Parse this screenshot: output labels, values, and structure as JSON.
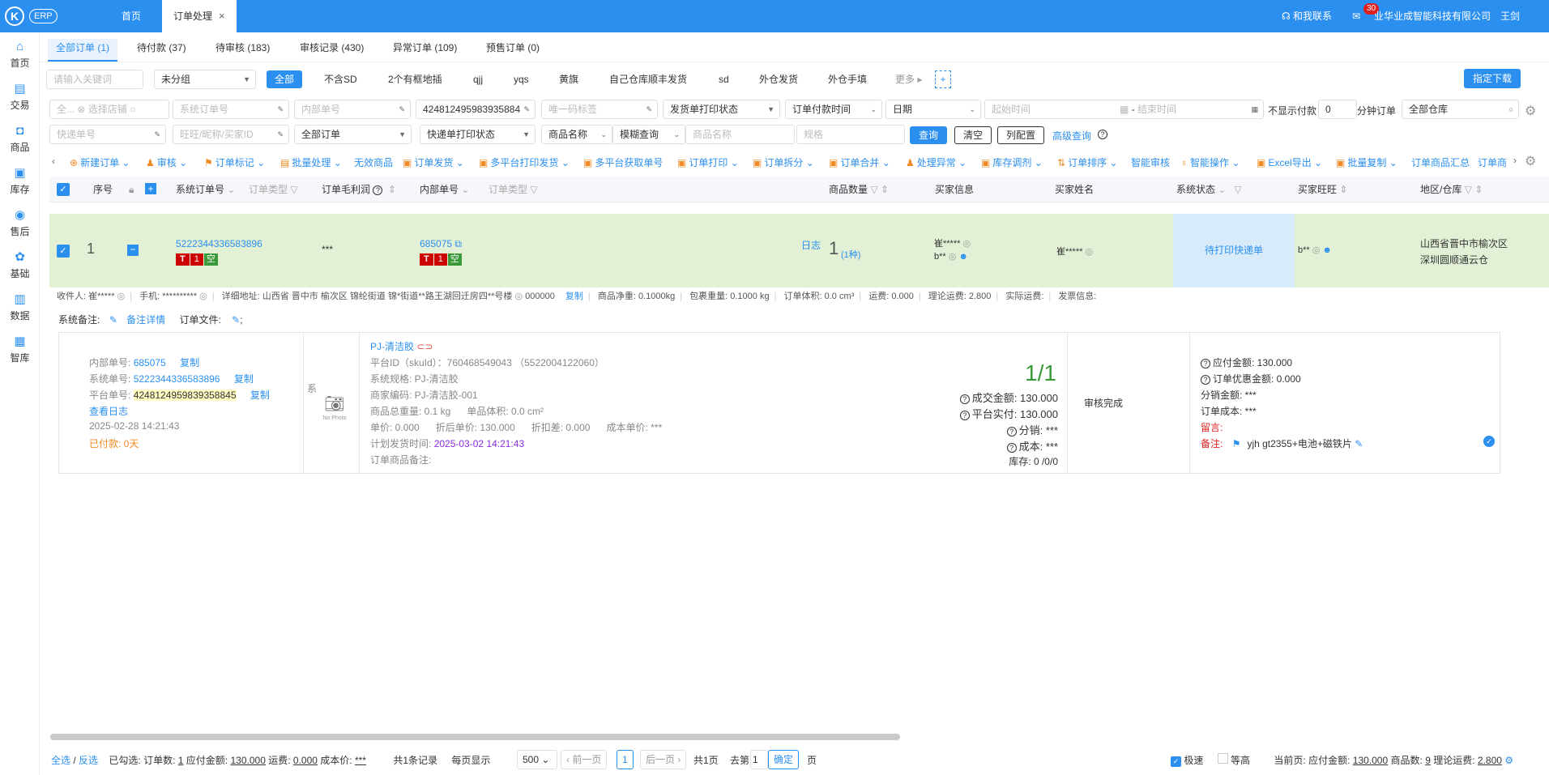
{
  "topbar": {
    "logo": "K",
    "erp": "ERP",
    "tabs": [
      {
        "label": "首页"
      },
      {
        "label": "订单处理"
      }
    ],
    "contact": "和我联系",
    "notifications": "30",
    "company": "业华业成智能科技有限公司",
    "user": "王剑"
  },
  "sidebar": [
    {
      "label": "首页",
      "icon": "home-icon"
    },
    {
      "label": "交易",
      "icon": "trade-icon"
    },
    {
      "label": "商品",
      "icon": "goods-icon"
    },
    {
      "label": "库存",
      "icon": "inventory-icon"
    },
    {
      "label": "售后",
      "icon": "after-sales-icon"
    },
    {
      "label": "基础",
      "icon": "settings-icon"
    },
    {
      "label": "数据",
      "icon": "chart-icon"
    },
    {
      "label": "智库",
      "icon": "library-icon"
    }
  ],
  "order_tabs": [
    "全部订单 (1)",
    "待付款 (37)",
    "待审核 (183)",
    "审核记录 (430)",
    "异常订单 (109)",
    "预售订单 (0)"
  ],
  "filter_row1": {
    "keyword_placeholder": "请输入关键词",
    "group": "未分组",
    "chips": [
      "全部",
      "不含SD",
      "2个有框地插",
      "qjj",
      "yqs",
      "黄旗",
      "自己仓库顺丰发货",
      "sd",
      "外仓发货",
      "外仓手填"
    ],
    "more": "更多",
    "add": "+",
    "download": "指定下载"
  },
  "filter_row2": {
    "shop": "全...",
    "shop_placeholder": "选择店铺",
    "sys_order_placeholder": "系统订单号",
    "inner_order_placeholder": "内部单号",
    "platform_order": "424812495983935884",
    "unique_code_placeholder": "唯一码标签",
    "print_status": "发货单打印状态",
    "pay_time": "订单付款时间",
    "date": "日期",
    "start_placeholder": "起始时间",
    "dash": "-",
    "end_placeholder": "结束时间",
    "hide_paid_label": "不显示付款",
    "hide_paid_value": "0",
    "split_label": "分钟订单",
    "warehouse": "全部仓库"
  },
  "filter_row3": {
    "express_placeholder": "快递单号",
    "buyer_placeholder": "旺旺/昵称/买家ID",
    "all_orders": "全部订单",
    "express_print": "快递单打印状态",
    "goods_name": "商品名称",
    "fuzzy": "模糊查询",
    "goods_name_placeholder": "商品名称",
    "spec_placeholder": "规格",
    "query": "查询",
    "clear": "清空",
    "columns": "列配置",
    "advanced": "高级查询"
  },
  "toolbar": [
    "新建订单",
    "审核",
    "订单标记",
    "批量处理",
    "无效商品",
    "订单发货",
    "多平台打印发货",
    "多平台获取单号",
    "订单打印",
    "订单拆分",
    "订单合并",
    "处理异常",
    "库存调剂",
    "订单排序",
    "智能审核",
    "智能操作",
    "Excel导出",
    "批量复制",
    "订单商品汇总",
    "订单商"
  ],
  "columns": {
    "seq": "序号",
    "sys_order": "系统订单号",
    "order_type": "订单类型",
    "margin": "订单毛利润",
    "inner_no": "内部单号",
    "order_type2": "订单类型",
    "qty": "商品数量",
    "buyer_info": "买家信息",
    "buyer_name": "买家姓名",
    "sys_status": "系统状态",
    "buyer_ww": "买家旺旺",
    "region": "地区/仓库"
  },
  "order": {
    "seq": "1",
    "sys_order": "5222344336583896",
    "tag_t": "T",
    "tag_1": "1",
    "tag_k": "空",
    "margin": "***",
    "inner_no": "685075",
    "log": "日志",
    "qty": "1",
    "qty_kinds": "(1种)",
    "buyer_info1": "崔*****",
    "buyer_info2": "b**",
    "buyer_name": "崔*****",
    "status": "待打印快递单",
    "buyer_ww": "b**",
    "region1": "山西省晋中市榆次区",
    "region2": "深圳圆顺通云仓"
  },
  "info_bar": {
    "receiver": "收件人: 崔*****",
    "phone": "手机: **********",
    "address": "详细地址: 山西省 晋中市 榆次区 锦纶街道 锦*街道**路王湖回迁房四**号楼",
    "zip": "000000",
    "copy": "复制",
    "net_weight": "商品净重: 0.1000kg",
    "pack_weight": "包裹重量: 0.1000 kg",
    "volume": "订单体积: 0.0 cm³",
    "freight": "运费: 0.000",
    "theory_freight": "理论运费: 2.800",
    "actual_freight": "实际运费:",
    "invoice": "发票信息:"
  },
  "remarks": {
    "sys_note": "系统备注:",
    "note_detail": "备注详情",
    "order_file": "订单文件:",
    "semi": ";"
  },
  "detail": {
    "inner_label": "内部单号:",
    "inner_value": "685075",
    "sys_label": "系统单号:",
    "sys_value": "5222344336583896",
    "plat_label": "平台单号:",
    "plat_value": "4248124959839358845",
    "copy": "复制",
    "view_log": "查看日志",
    "created": "2025-02-28 14:21:43",
    "paid": "已付款: 0天",
    "sys_side": "系",
    "no_photo": "No Photo",
    "product_name": "PJ-清洁胶",
    "platform_id": "平台ID（skuId）：760468549043 （5522004122060）",
    "sys_spec": "系统规格: PJ-清洁胶",
    "merchant_code": "商家编码: PJ-清洁胶-001",
    "total_weight": "商品总重量: 0.1 kg",
    "unit_volume": "单品体积: 0.0 cm²",
    "unit_price": "单价: 0.000",
    "discount_price": "折后单价: 130.000",
    "discount": "折扣差: 0.000",
    "cost_price": "成本单价: ***",
    "ship_label": "计划发货时间:",
    "ship_time": "2025-03-02 14:21:43",
    "goods_note": "订单商品备注:",
    "ratio": "1/1",
    "deal_amount": "成交金额: 130.000",
    "platform_paid": "平台实付: 130.000",
    "share": "分销: ***",
    "cost": "成本: ***",
    "stock": "库存: 0 /0/0",
    "audit_done": "审核完成",
    "payable": "应付金额: 130.000",
    "order_discount": "订单优惠金额: 0.000",
    "dist_amount": "分销金额: ***",
    "order_cost": "订单成本: ***",
    "leave_msg": "留言:",
    "note_label": "备注:",
    "note_value": "yjh gt2355+电池+磁铁片"
  },
  "footer": {
    "select_all": "全选",
    "slash": "/",
    "invert": "反选",
    "checked": "已勾选: 订单数:",
    "checked_count": "1",
    "payable_label": "应付金额:",
    "payable": "130.000",
    "freight_label": "运费:",
    "freight": "0.000",
    "cost_label": "成本价:",
    "cost": "***",
    "records": "共1条记录",
    "per_page_label": "每页显示",
    "per_page": "500",
    "prev": "前一页",
    "page": "1",
    "next": "后一页",
    "total_pages": "共1页",
    "goto_label": "去第",
    "goto_value": "1",
    "confirm": "确定",
    "page_unit": "页",
    "fast": "极速",
    "equal_height": "等高",
    "current": "当前页: 应付金额:",
    "current_payable": "130.000",
    "goods_count_label": "商品数:",
    "goods_count": "9",
    "theory_label": "理论运费:",
    "theory": "2.800"
  },
  "colors": {
    "primary": "#2b8ff0",
    "row": "#e2f1d6",
    "status": "#d7ebfb",
    "red": "#cc0000",
    "green": "#3a9a3a"
  }
}
